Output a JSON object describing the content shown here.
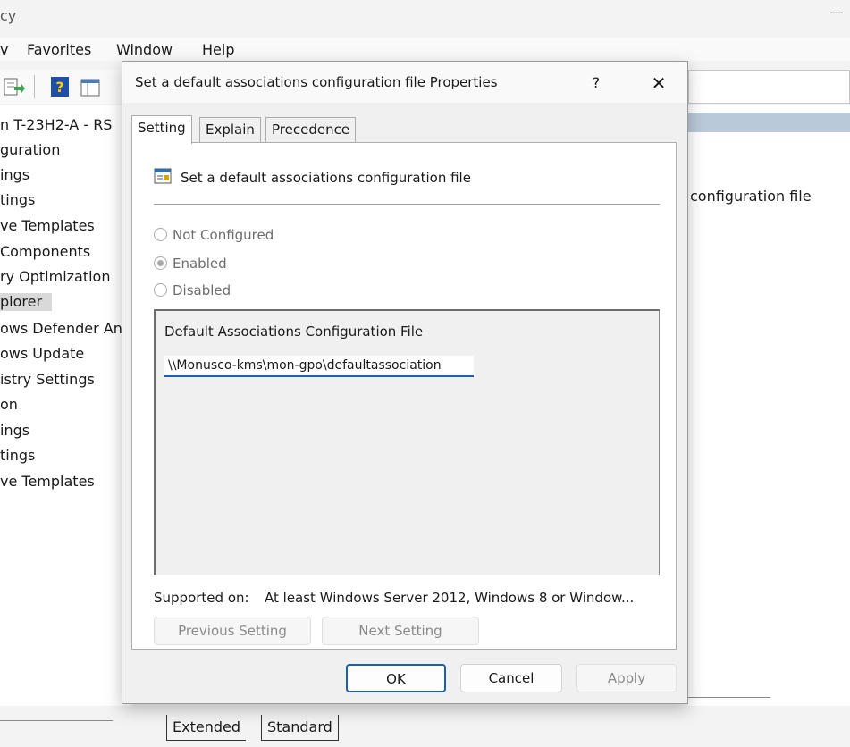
{
  "background_window": {
    "title": "cy",
    "menu": [
      "v",
      "Favorites",
      "Window",
      "Help"
    ],
    "tree_items": [
      "n T-23H2-A - RS",
      "guration",
      "ings",
      "tings",
      "ve Templates",
      " Components",
      "ry Optimization",
      "plorer",
      "ows Defender An",
      "ows Update",
      "istry Settings",
      "on",
      "ings",
      "tings",
      "ve Templates"
    ],
    "selected_tree_index": 7,
    "right_pane_text": "configuration file",
    "bottom_tabs": [
      "Extended",
      "Standard"
    ]
  },
  "dialog": {
    "title": "Set a default associations configuration file Properties",
    "help_label": "?",
    "close_label": "✕",
    "tabs": [
      "Setting",
      "Explain",
      "Precedence"
    ],
    "active_tab": "Setting",
    "policy_name": "Set a default associations configuration file",
    "radios": {
      "not_configured": "Not Configured",
      "enabled": "Enabled",
      "disabled": "Disabled",
      "selected": "enabled"
    },
    "options": {
      "label": "Default Associations Configuration File",
      "value": "\\\\Monusco-kms\\mon-gpo\\defaultassociation"
    },
    "supported_on_label": "Supported on:",
    "supported_on_value": "At least Windows Server 2012, Windows 8 or Window...",
    "previous_setting_label": "Previous Setting",
    "next_setting_label": "Next Setting",
    "ok_label": "OK",
    "cancel_label": "Cancel",
    "apply_label": "Apply"
  },
  "colors": {
    "accent": "#1a5fb4",
    "selection_header": "#b9c9d9"
  }
}
